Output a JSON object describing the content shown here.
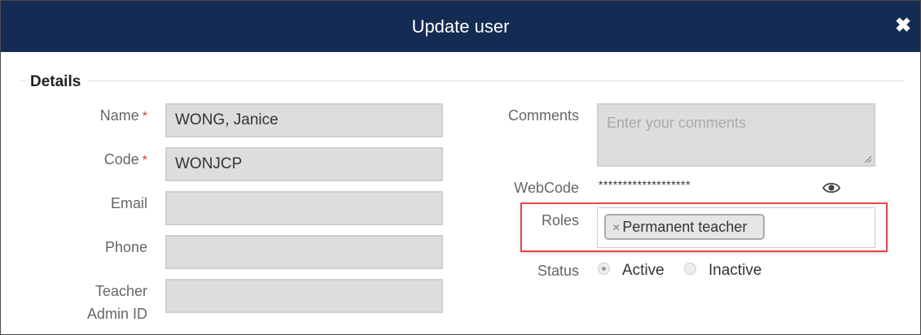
{
  "dialog": {
    "title": "Update user",
    "close_icon": "close-icon"
  },
  "details": {
    "legend": "Details",
    "name_label": "Name",
    "name_value": "WONG, Janice",
    "code_label": "Code",
    "code_value": "WONJCP",
    "required_mark": "*",
    "email_label": "Email",
    "email_value": "",
    "phone_label": "Phone",
    "phone_value": "",
    "teacher_admin_label_1": "Teacher",
    "teacher_admin_label_2": "Admin ID",
    "teacher_admin_value": "",
    "comments_label": "Comments",
    "comments_placeholder": "Enter your comments",
    "webcode_label": "WebCode",
    "webcode_value": "*******************",
    "webcode_icon": "eye-icon",
    "roles_label": "Roles",
    "roles": [
      "Permanent teacher"
    ],
    "role_remove": "×",
    "status_label": "Status",
    "status_options": [
      "Active",
      "Inactive"
    ],
    "status_selected": "Active"
  },
  "colors": {
    "header_bg": "#142c53",
    "highlight": "#e5484d",
    "required": "#e23b3b"
  }
}
